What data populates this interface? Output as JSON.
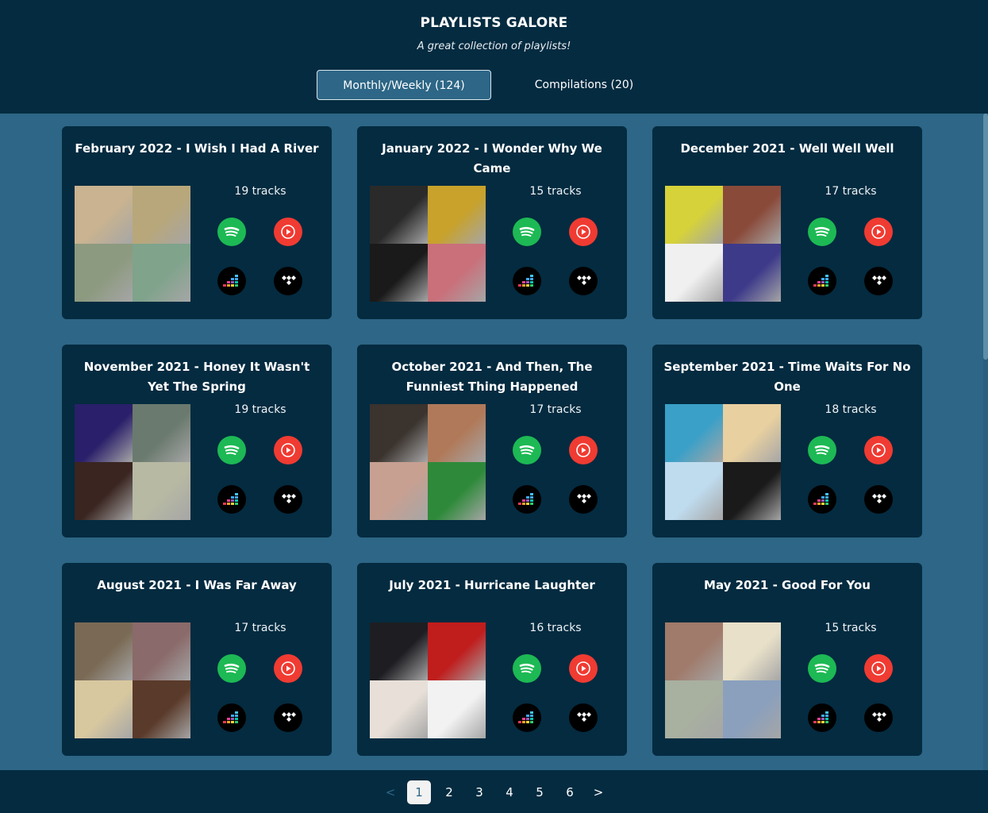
{
  "header": {
    "title": "PLAYLISTS GALORE",
    "subtitle": "A great collection of playlists!",
    "tabs": [
      {
        "label": "Monthly/Weekly (124)",
        "active": true
      },
      {
        "label": "Compilations (20)",
        "active": false
      }
    ]
  },
  "colors": {
    "background": "#2d6686",
    "card": "#042b40",
    "spotify": "#1db954",
    "youtube": "#f03b32",
    "deezer": "#000000",
    "tidal": "#000000"
  },
  "service_icons": [
    "spotify-icon",
    "youtube-music-icon",
    "deezer-icon",
    "tidal-icon"
  ],
  "playlists": [
    {
      "title": "February 2022 - I Wish I Had A River",
      "tracks": "19 tracks",
      "covers": [
        "#c9b390",
        "#b8a77a",
        "#8c9a7f",
        "#7fa38b"
      ]
    },
    {
      "title": "January 2022 - I Wonder Why We Came",
      "tracks": "15 tracks",
      "covers": [
        "#2a2a2a",
        "#c8a22a",
        "#1a1a1a",
        "#c9707a"
      ]
    },
    {
      "title": "December 2021 - Well Well Well",
      "tracks": "17 tracks",
      "covers": [
        "#d6d23a",
        "#8a4a3a",
        "#f0f0f0",
        "#3d3a8a"
      ]
    },
    {
      "title": "November 2021 - Honey It Wasn't Yet The Spring",
      "tracks": "19 tracks",
      "covers": [
        "#2a1f6a",
        "#6a7a6e",
        "#3a2520",
        "#b7b9a3"
      ]
    },
    {
      "title": "October 2021 - And Then, The Funniest Thing Happened",
      "tracks": "17 tracks",
      "covers": [
        "#3a332e",
        "#b07a5a",
        "#c7a092",
        "#2e8a3a"
      ]
    },
    {
      "title": "September 2021 - Time Waits For No One",
      "tracks": "18 tracks",
      "covers": [
        "#3aa0c8",
        "#e8d0a0",
        "#bfdcef",
        "#1a1a1a"
      ]
    },
    {
      "title": "August 2021 - I Was Far Away",
      "tracks": "17 tracks",
      "covers": [
        "#7a6a55",
        "#8a6a6a",
        "#d8c8a0",
        "#5a3a2a"
      ]
    },
    {
      "title": "July 2021 - Hurricane Laughter",
      "tracks": "16 tracks",
      "covers": [
        "#1e1e22",
        "#c01d1d",
        "#e8e0d8",
        "#f2f2f2"
      ]
    },
    {
      "title": "May 2021 - Good For You",
      "tracks": "15 tracks",
      "covers": [
        "#a07a6a",
        "#e8e0c8",
        "#a8b0a0",
        "#8aa0bd"
      ]
    }
  ],
  "pagination": {
    "prev": "<",
    "next": ">",
    "pages": [
      "1",
      "2",
      "3",
      "4",
      "5",
      "6"
    ],
    "current": "1"
  }
}
